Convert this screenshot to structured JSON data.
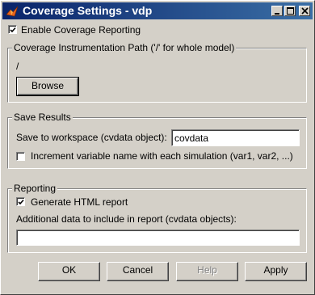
{
  "window": {
    "title": "Coverage Settings - vdp",
    "controls": [
      "minimize-icon",
      "maximize-icon",
      "close-icon"
    ]
  },
  "enable": {
    "label": "Enable Coverage Reporting",
    "checked": true
  },
  "instrumentation": {
    "group_title": "Coverage Instrumentation Path ('/' for whole model)",
    "path": "/",
    "browse_label": "Browse"
  },
  "save": {
    "group_title": "Save Results",
    "workspace_label": "Save to workspace (cvdata object):",
    "workspace_value": "covdata",
    "increment_label": "Increment variable name with each simulation (var1, var2, ...)",
    "increment_checked": false
  },
  "reporting": {
    "group_title": "Reporting",
    "html_label": "Generate HTML report",
    "html_checked": true,
    "additional_label": "Additional data to include in report (cvdata objects):",
    "additional_value": ""
  },
  "buttons": {
    "ok": "OK",
    "cancel": "Cancel",
    "help": "Help",
    "apply": "Apply"
  }
}
